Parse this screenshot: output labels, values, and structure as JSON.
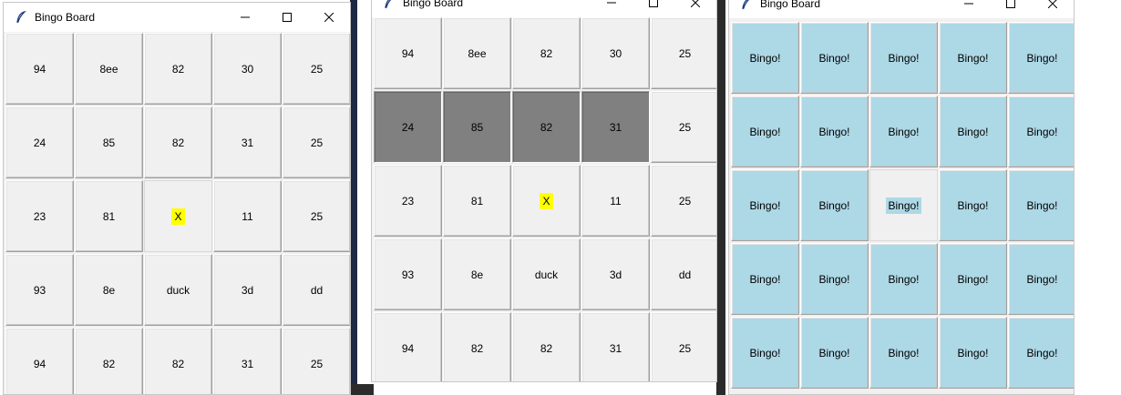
{
  "windows": [
    {
      "title": "Bingo Board",
      "cells": [
        [
          "94",
          "8ee",
          "82",
          "30",
          "25"
        ],
        [
          "24",
          "85",
          "82",
          "31",
          "25"
        ],
        [
          "23",
          "81",
          "X",
          "11",
          "25"
        ],
        [
          "93",
          "8e",
          "duck",
          "3d",
          "dd"
        ],
        [
          "94",
          "82",
          "82",
          "31",
          "25"
        ]
      ]
    },
    {
      "title": "Bingo Board",
      "cells": [
        [
          "94",
          "8ee",
          "82",
          "30",
          "25"
        ],
        [
          "24",
          "85",
          "82",
          "31",
          "25"
        ],
        [
          "23",
          "81",
          "X",
          "11",
          "25"
        ],
        [
          "93",
          "8e",
          "duck",
          "3d",
          "dd"
        ],
        [
          "94",
          "82",
          "82",
          "31",
          "25"
        ]
      ],
      "marked_row": 1,
      "marked_count": 4
    },
    {
      "title": "Bingo Board",
      "cells": [
        [
          "Bingo!",
          "Bingo!",
          "Bingo!",
          "Bingo!",
          "Bingo!"
        ],
        [
          "Bingo!",
          "Bingo!",
          "Bingo!",
          "Bingo!",
          "Bingo!"
        ],
        [
          "Bingo!",
          "Bingo!",
          "Bingo!",
          "Bingo!",
          "Bingo!"
        ],
        [
          "Bingo!",
          "Bingo!",
          "Bingo!",
          "Bingo!",
          "Bingo!"
        ],
        [
          "Bingo!",
          "Bingo!",
          "Bingo!",
          "Bingo!",
          "Bingo!"
        ]
      ]
    }
  ],
  "colors": {
    "highlight": "#ffff00",
    "marked": "#808080",
    "bingo": "#add8e6",
    "cell_bg": "#f0f0f0"
  },
  "icons": {
    "app": "feather-icon",
    "minimize": "minimize-icon",
    "maximize": "maximize-icon",
    "close": "close-icon"
  }
}
